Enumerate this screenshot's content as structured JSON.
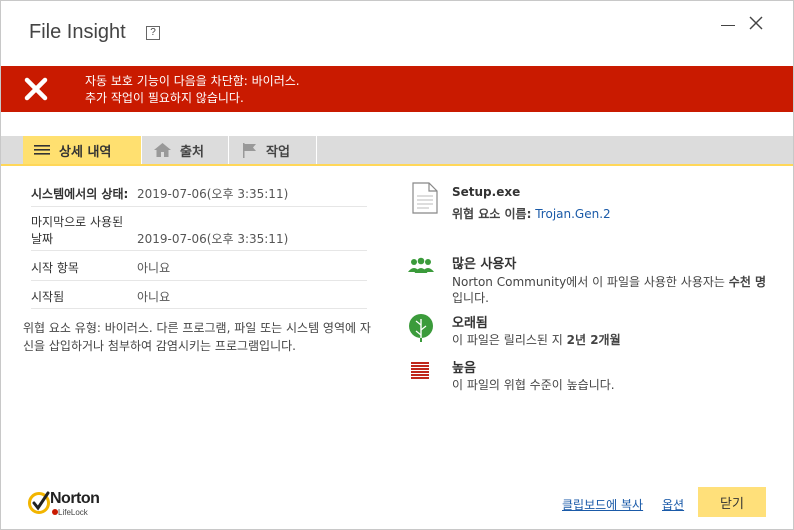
{
  "window": {
    "title": "File Insight",
    "help_label": "?"
  },
  "alert": {
    "line1": "자동 보호 기능이 다음을 차단함: 바이러스.",
    "line2": "추가 작업이 필요하지 않습니다.",
    "color": "#c91a00"
  },
  "tabs": [
    {
      "label": "상세 내역",
      "icon": "list-icon",
      "active": true
    },
    {
      "label": "출처",
      "icon": "home-icon",
      "active": false
    },
    {
      "label": "작업",
      "icon": "flag-icon",
      "active": false
    }
  ],
  "details": {
    "rows": [
      {
        "label": "시스템에서의 상태:",
        "value": "2019-07-06(오후 3:35:11)"
      },
      {
        "label_line1": "마지막으로 사용된",
        "label_line2": "날짜",
        "value": "2019-07-06(오후 3:35:11)"
      },
      {
        "label": "시작 항목",
        "value": "아니요"
      },
      {
        "label": "시작됨",
        "value": "아니요"
      }
    ],
    "description_line1": "위협 요소 유형: 바이러스. 다른 프로그램, 파일 또는 시스템 영역에 자",
    "description_line2": "신을 삽입하거나 첨부하여 감염시키는 프로그램입니다."
  },
  "file": {
    "name": "Setup.exe",
    "threat_label": "위협 요소 이름:",
    "threat_name": "Trojan.Gen.2"
  },
  "insights": {
    "users": {
      "title": "많은 사용자",
      "text_prefix": "Norton Community에서 이 파일을 사용한 사용자는",
      "text_bold": "수천 명",
      "text_line2": "입니다."
    },
    "age": {
      "title": "오래됨",
      "text_prefix": "이 파일은 릴리스된 지",
      "text_bold": "2년 2개월"
    },
    "risk": {
      "title": "높음",
      "text": "이 파일의 위협 수준이 높습니다."
    }
  },
  "footer": {
    "logo_text": "Norton",
    "logo_sub": "LifeLock",
    "copy_link": "클립보드에 복사",
    "options_link": "옵션",
    "close_label": "닫기"
  },
  "colors": {
    "accent": "#ffe070",
    "tab_bar": "#dcdcdc",
    "green": "#3b9b3b",
    "risk_red": "#c0261b",
    "link": "#1a5aa8"
  }
}
